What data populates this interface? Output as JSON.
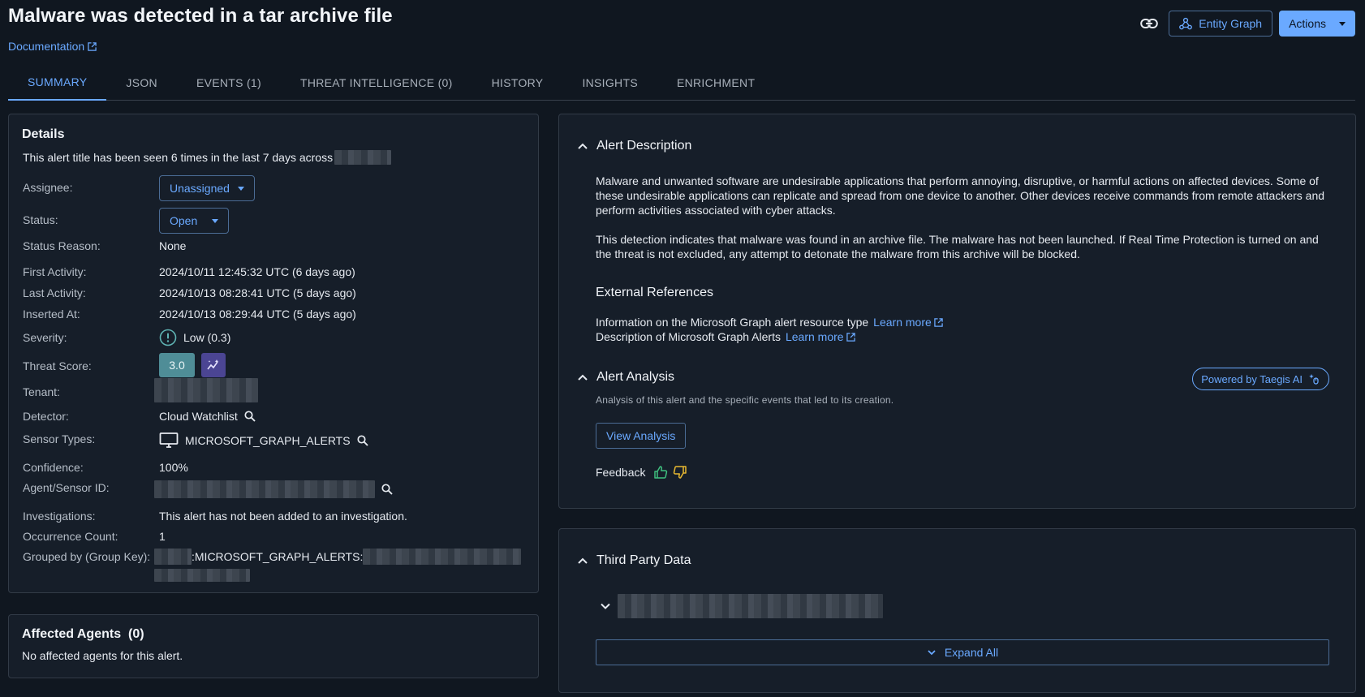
{
  "header": {
    "title": "Malware was detected in a tar archive file",
    "documentation_label": "Documentation",
    "entity_graph_label": "Entity Graph",
    "actions_label": "Actions"
  },
  "tabs": [
    {
      "label": "SUMMARY",
      "active": true
    },
    {
      "label": "JSON",
      "active": false
    },
    {
      "label": "EVENTS (1)",
      "active": false
    },
    {
      "label": "THREAT INTELLIGENCE (0)",
      "active": false
    },
    {
      "label": "HISTORY",
      "active": false
    },
    {
      "label": "INSIGHTS",
      "active": false
    },
    {
      "label": "ENRICHMENT",
      "active": false
    }
  ],
  "details": {
    "title": "Details",
    "seen_text": "This alert title has been seen 6 times in the last 7 days across",
    "assignee_label": "Assignee:",
    "assignee_value": "Unassigned",
    "status_label": "Status:",
    "status_value": "Open",
    "status_reason_label": "Status Reason:",
    "status_reason_value": "None",
    "first_activity_label": "First Activity:",
    "first_activity_value": "2024/10/11 12:45:32 UTC (6 days ago)",
    "last_activity_label": "Last Activity:",
    "last_activity_value": "2024/10/13 08:28:41 UTC (5 days ago)",
    "inserted_at_label": "Inserted At:",
    "inserted_at_value": "2024/10/13 08:29:44 UTC (5 days ago)",
    "severity_label": "Severity:",
    "severity_value": "Low (0.3)",
    "threat_score_label": "Threat Score:",
    "threat_score_value": "3.0",
    "tenant_label": "Tenant:",
    "detector_label": "Detector:",
    "detector_value": "Cloud Watchlist",
    "sensor_types_label": "Sensor Types:",
    "sensor_types_value": "MICROSOFT_GRAPH_ALERTS",
    "confidence_label": "Confidence:",
    "confidence_value": "100%",
    "agent_sensor_label": "Agent/Sensor ID:",
    "investigations_label": "Investigations:",
    "investigations_value": "This alert has not been added to an investigation.",
    "occurrence_label": "Occurrence Count:",
    "occurrence_value": "1",
    "grouped_label": "Grouped by (Group Key):",
    "grouped_value": ":MICROSOFT_GRAPH_ALERTS:"
  },
  "affected": {
    "title": "Affected Agents",
    "count": "(0)",
    "text": "No affected agents for this alert."
  },
  "alert_description": {
    "heading": "Alert Description",
    "para1": "Malware and unwanted software are undesirable applications that perform annoying, disruptive, or harmful actions on affected devices. Some of these undesirable applications can replicate and spread from one device to another. Other devices receive commands from remote attackers and perform activities associated with cyber attacks.",
    "para2": "This detection indicates that malware was found in an archive file.  The malware has not been launched.  If Real Time Protection is turned on and the threat is not excluded, any attempt to detonate the malware from this archive will be blocked.",
    "external_refs_heading": "External References",
    "ref1_text": "Information on the Microsoft Graph alert resource type",
    "ref2_text": "Description of Microsoft Graph Alerts",
    "learn_more": "Learn more"
  },
  "alert_analysis": {
    "heading": "Alert Analysis",
    "powered_by": "Powered by Taegis AI",
    "subtitle": "Analysis of this alert and the specific events that led to its creation.",
    "view_button": "View Analysis",
    "feedback_label": "Feedback"
  },
  "third_party": {
    "heading": "Third Party Data",
    "expand_all": "Expand All"
  },
  "colors": {
    "background": "#101720",
    "panel": "#161e29",
    "accent": "#6aa9ff",
    "threat_score": "#4f8d97",
    "ai_badge": "#4b4593",
    "thumbs_up": "#3fbf7f",
    "thumbs_down": "#e8b931"
  },
  "icons": [
    "link-icon",
    "entity-graph-icon",
    "external-link-icon",
    "severity-alert-icon",
    "ai-sparkle-icon",
    "search-icon",
    "monitor-icon",
    "chevron-up-icon",
    "chevron-down-icon",
    "thumbs-up-icon",
    "thumbs-down-icon"
  ]
}
